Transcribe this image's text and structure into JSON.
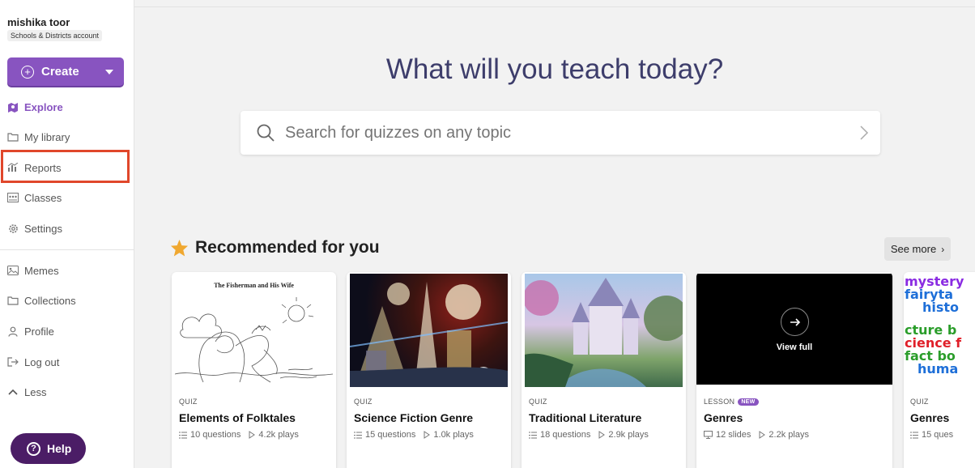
{
  "user": {
    "name": "mishika toor",
    "account_type": "Schools & Districts account"
  },
  "create": {
    "label": "Create"
  },
  "nav": {
    "primary": [
      {
        "label": "Explore",
        "icon": "explore-icon"
      },
      {
        "label": "My library",
        "icon": "folder-icon"
      },
      {
        "label": "Reports",
        "icon": "reports-icon"
      },
      {
        "label": "Classes",
        "icon": "classes-icon"
      },
      {
        "label": "Settings",
        "icon": "gear-icon"
      }
    ],
    "secondary": [
      {
        "label": "Memes",
        "icon": "image-icon"
      },
      {
        "label": "Collections",
        "icon": "folder-icon"
      },
      {
        "label": "Profile",
        "icon": "user-icon"
      },
      {
        "label": "Log out",
        "icon": "logout-icon"
      },
      {
        "label": "Less",
        "icon": "chevron-up-icon"
      }
    ]
  },
  "help": {
    "label": "Help"
  },
  "hero": {
    "title": "What will you teach today?"
  },
  "search": {
    "placeholder": "Search for quizzes on any topic"
  },
  "recommended": {
    "title": "Recommended for you",
    "see_more": "See more",
    "cards": [
      {
        "type": "QUIZ",
        "title": "Elements of Folktales",
        "count": "10 questions",
        "plays": "4.2k plays",
        "thumb_text": "The Fisherman and His Wife"
      },
      {
        "type": "QUIZ",
        "title": "Science Fiction Genre",
        "count": "15 questions",
        "plays": "1.0k plays"
      },
      {
        "type": "QUIZ",
        "title": "Traditional Literature",
        "count": "18 questions",
        "plays": "2.9k plays"
      },
      {
        "type": "LESSON",
        "badge": "NEW",
        "title": "Genres",
        "count": "12 slides",
        "plays": "2.2k plays",
        "overlay": "View full"
      },
      {
        "type": "QUIZ",
        "title": "Genres",
        "count": "15 ques",
        "thumb_lines": [
          "mystery",
          "fairyta",
          "histo",
          "cture b",
          "cience f",
          "fact bo",
          "huma"
        ]
      }
    ]
  },
  "colors": {
    "brand": "#8854c0",
    "help": "#4b1d66",
    "highlight": "#e0472b",
    "star": "#f0a830"
  }
}
